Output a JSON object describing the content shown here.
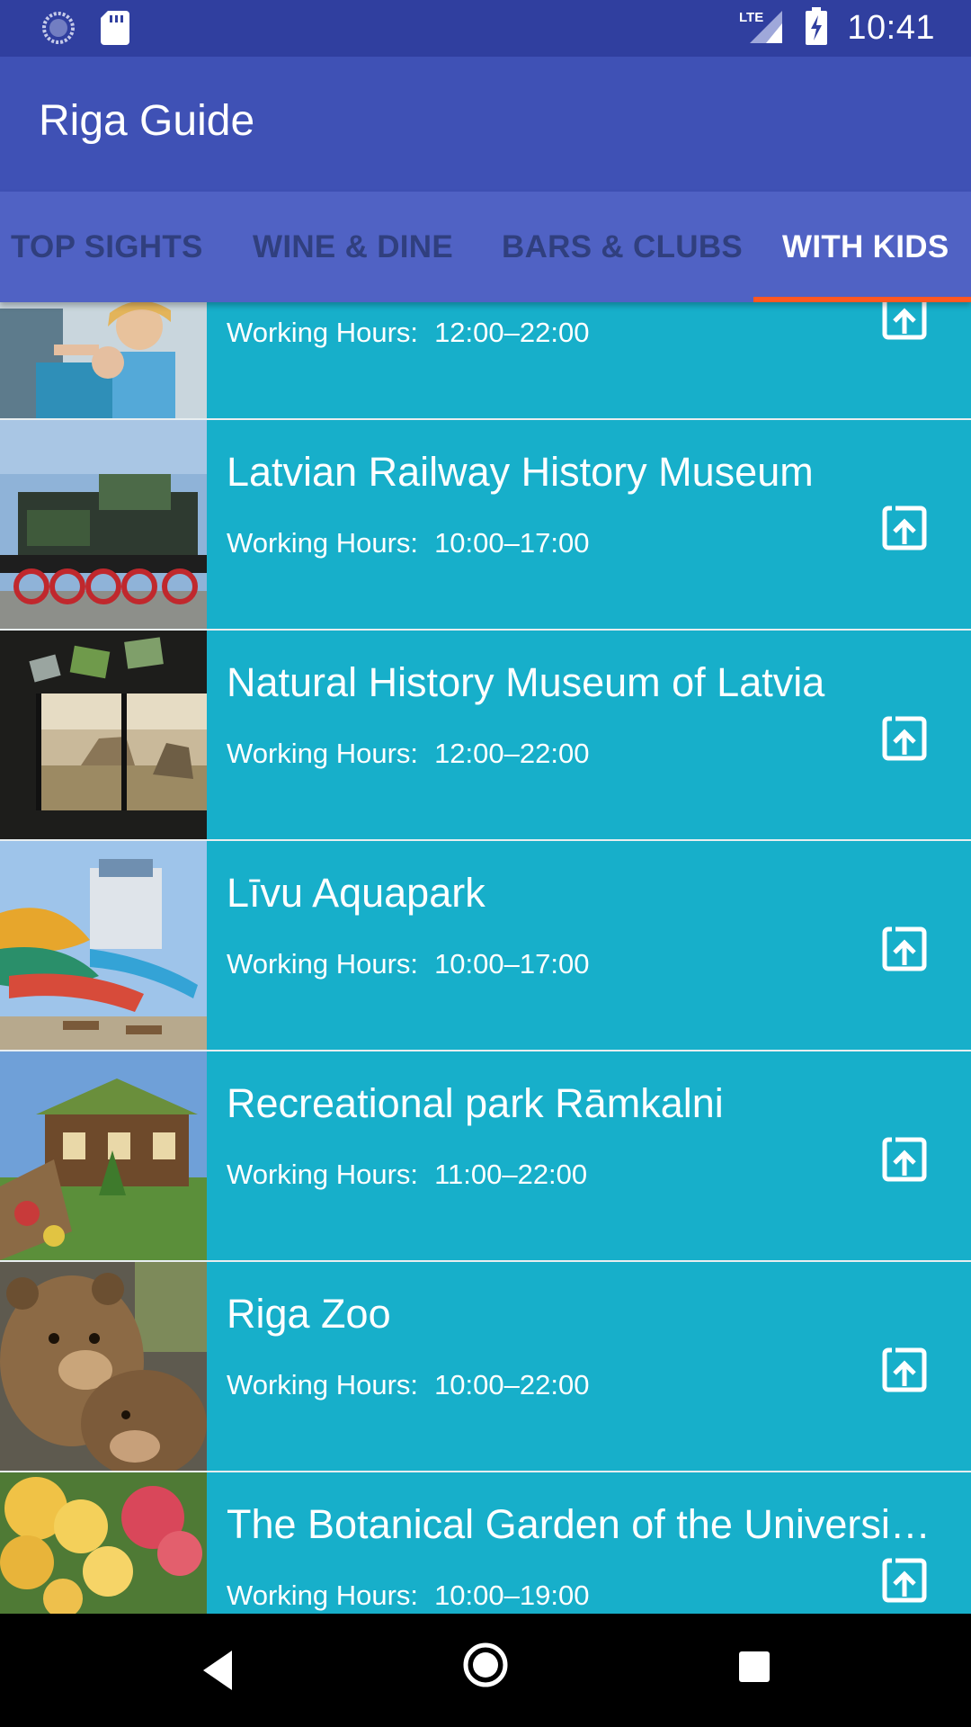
{
  "status_bar": {
    "time": "10:41",
    "icons": [
      "sync-icon",
      "sd-card-icon",
      "lte-signal-icon",
      "battery-charging-icon"
    ]
  },
  "app_bar": {
    "title": "Riga Guide"
  },
  "tabs": [
    {
      "label": "TOP SIGHTS",
      "active": false
    },
    {
      "label": "WINE & DINE",
      "active": false
    },
    {
      "label": "BARS & CLUBS",
      "active": false
    },
    {
      "label": "WITH KIDS",
      "active": true
    }
  ],
  "colors": {
    "status_bar": "#303f9f",
    "app_bar": "#3f51b5",
    "tab_bar": "#5062c4",
    "tab_indicator": "#ff5722",
    "list_item": "#17afca"
  },
  "list": {
    "hours_label": "Working Hours:",
    "items": [
      {
        "title": "",
        "hours": "12:00–22:00",
        "image": "kids-exhibit-photo"
      },
      {
        "title": "Latvian Railway History Museum",
        "hours": "10:00–17:00",
        "image": "steam-locomotive-photo"
      },
      {
        "title": "Natural History Museum of Latvia",
        "hours": "12:00–22:00",
        "image": "museum-diorama-photo"
      },
      {
        "title": "Līvu Aquapark",
        "hours": "10:00–17:00",
        "image": "water-slides-photo"
      },
      {
        "title": "Recreational park Rāmkalni",
        "hours": "11:00–22:00",
        "image": "wooden-lodge-photo"
      },
      {
        "title": "Riga Zoo",
        "hours": "10:00–22:00",
        "image": "brown-bears-photo"
      },
      {
        "title": "The Botanical Garden of the Universi…",
        "hours": "10:00–19:00",
        "image": "flower-garden-photo"
      }
    ]
  },
  "nav_bar": {
    "buttons": [
      "back-icon",
      "home-icon",
      "recents-icon"
    ]
  }
}
